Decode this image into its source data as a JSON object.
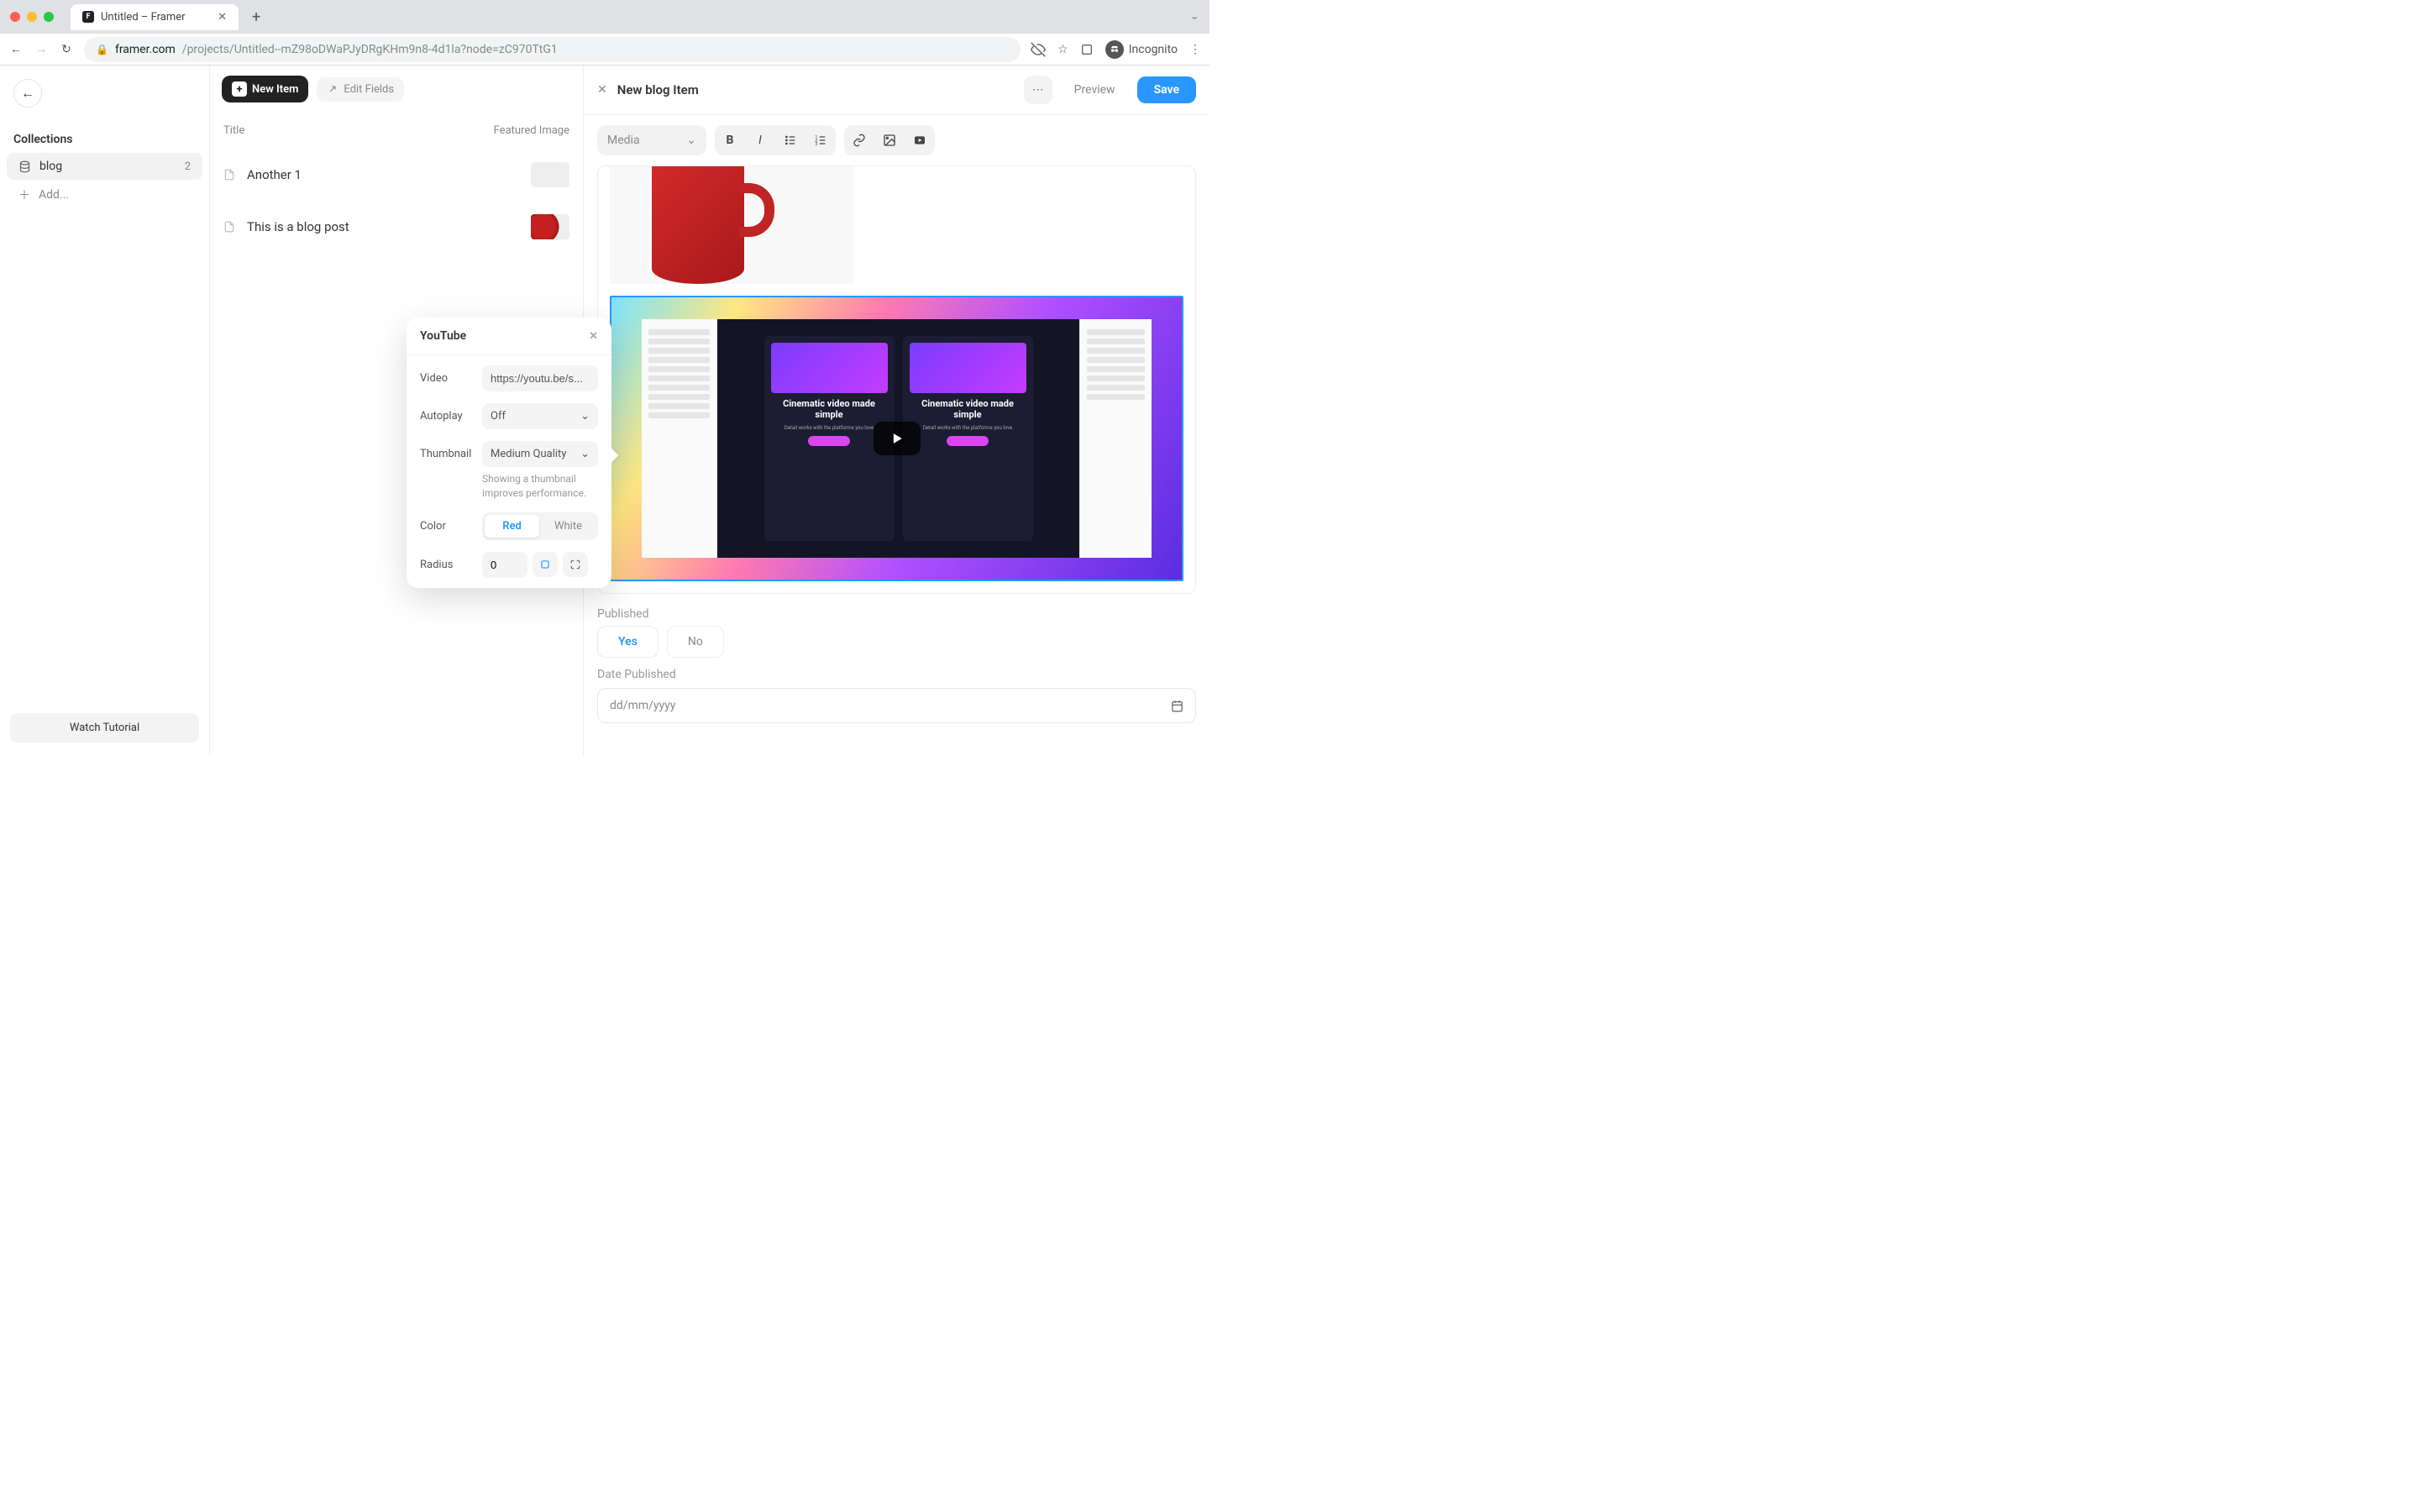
{
  "browser": {
    "tab_title": "Untitled – Framer",
    "url_domain": "framer.com",
    "url_path": "/projects/Untitled--mZ98oDWaPJyDRgKHm9n8-4d1la?node=zC970TtG1",
    "incognito_label": "Incognito"
  },
  "sidebar": {
    "back_aria": "Back",
    "collections_heading": "Collections",
    "items": [
      {
        "name": "blog",
        "count": "2"
      }
    ],
    "add_label": "Add...",
    "watch_tutorial": "Watch Tutorial"
  },
  "list": {
    "new_item_label": "New Item",
    "edit_fields_label": "Edit Fields",
    "col_title": "Title",
    "col_featured": "Featured Image",
    "rows": [
      {
        "title": "Another 1"
      },
      {
        "title": "This is a blog post"
      }
    ]
  },
  "editor": {
    "header_title": "New blog Item",
    "preview_label": "Preview",
    "save_label": "Save",
    "media_label": "Media",
    "published_label": "Published",
    "published_yes": "Yes",
    "published_no": "No",
    "date_label": "Date Published",
    "date_placeholder": "dd/mm/yyyy",
    "card_headline_1": "Cinematic video made simple",
    "card_headline_2": "Cinematic video made simple",
    "card_sub_1": "Detail works with the platforms you love",
    "card_sub_2": "Detail works with the platforms you love"
  },
  "popover": {
    "title": "YouTube",
    "video_label": "Video",
    "video_value": "https://youtu.be/s...",
    "autoplay_label": "Autoplay",
    "autoplay_value": "Off",
    "thumbnail_label": "Thumbnail",
    "thumbnail_value": "Medium Quality",
    "thumbnail_hint": "Showing a thumbnail improves performance.",
    "color_label": "Color",
    "color_red": "Red",
    "color_white": "White",
    "radius_label": "Radius",
    "radius_value": "0"
  }
}
